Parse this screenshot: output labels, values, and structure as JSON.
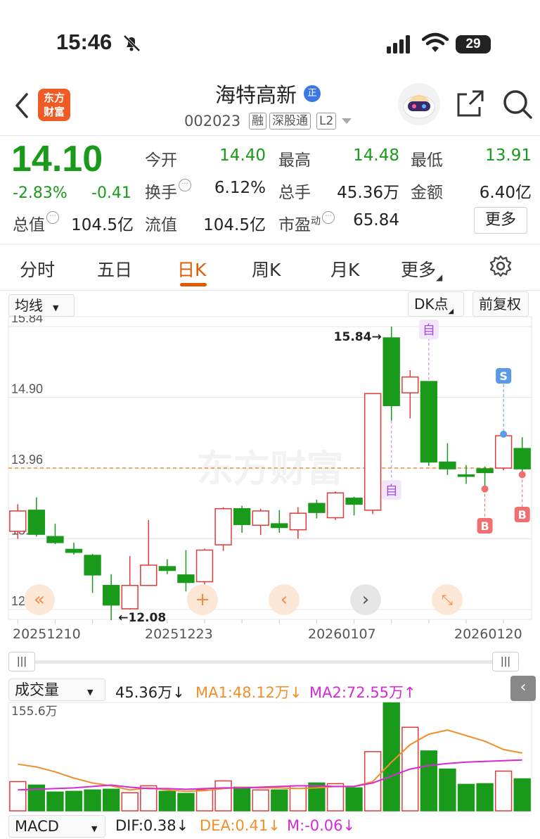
{
  "status": {
    "time": "15:46",
    "battery": "29"
  },
  "header": {
    "logo_text_1": "东方",
    "logo_text_2": "财富",
    "stock_name": "海特高新",
    "badge": "正",
    "stock_code": "002023",
    "tags": [
      "融",
      "深股通",
      "L2"
    ]
  },
  "quote": {
    "price": "14.10",
    "change_pct": "-2.83%",
    "change": "-0.41",
    "open_label": "今开",
    "open": "14.40",
    "high_label": "最高",
    "high": "14.48",
    "low_label": "最低",
    "low": "13.91",
    "turnover_label": "换手",
    "turnover": "6.12%",
    "volume_label": "总手",
    "volume": "45.36万",
    "amount_label": "金额",
    "amount": "6.40亿",
    "mcap_label": "总值",
    "mcap": "104.5亿",
    "float_label": "流值",
    "float": "104.5亿",
    "pe_label": "市盈",
    "pe_sup": "动",
    "pe": "65.84",
    "more": "更多"
  },
  "tabs": [
    "分时",
    "五日",
    "日K",
    "周K",
    "月K",
    "更多"
  ],
  "active_tab": "日K",
  "toolbar": {
    "ma_select": "均线",
    "dk": "DK点",
    "adjust": "前复权"
  },
  "chart_data": {
    "type": "candlestick",
    "y_ticks": [
      "15.84",
      "14.90",
      "13.96",
      "13.02",
      "12.08"
    ],
    "ylim": [
      12.08,
      15.84
    ],
    "x_ticks": [
      "20251210",
      "20251223",
      "20260107",
      "20260120"
    ],
    "high_marker": "15.84",
    "low_marker": "12.08",
    "last_close_line": 13.96,
    "candles": [
      {
        "o": 13.12,
        "c": 13.39,
        "h": 13.48,
        "l": 13.02
      },
      {
        "o": 13.4,
        "c": 13.08,
        "h": 13.57,
        "l": 13.05
      },
      {
        "o": 13.05,
        "c": 12.97,
        "h": 13.22,
        "l": 12.95
      },
      {
        "o": 12.88,
        "c": 12.84,
        "h": 12.97,
        "l": 12.81
      },
      {
        "o": 12.8,
        "c": 12.54,
        "h": 12.82,
        "l": 12.3
      },
      {
        "o": 12.4,
        "c": 12.14,
        "h": 12.55,
        "l": 11.94
      },
      {
        "o": 12.09,
        "c": 12.4,
        "h": 12.79,
        "l": 12.08
      },
      {
        "o": 12.4,
        "c": 12.67,
        "h": 13.27,
        "l": 12.4
      },
      {
        "o": 12.65,
        "c": 12.6,
        "h": 12.75,
        "l": 12.55
      },
      {
        "o": 12.54,
        "c": 12.44,
        "h": 12.87,
        "l": 12.32
      },
      {
        "o": 12.45,
        "c": 12.87,
        "h": 12.89,
        "l": 12.33
      },
      {
        "o": 12.94,
        "c": 13.42,
        "h": 13.44,
        "l": 12.86
      },
      {
        "o": 13.42,
        "c": 13.21,
        "h": 13.46,
        "l": 13.1
      },
      {
        "o": 13.2,
        "c": 13.39,
        "h": 13.42,
        "l": 13.07
      },
      {
        "o": 13.22,
        "c": 13.17,
        "h": 13.4,
        "l": 13.1
      },
      {
        "o": 13.14,
        "c": 13.36,
        "h": 13.44,
        "l": 13.02
      },
      {
        "o": 13.49,
        "c": 13.37,
        "h": 13.54,
        "l": 13.29
      },
      {
        "o": 13.3,
        "c": 13.63,
        "h": 13.65,
        "l": 13.27
      },
      {
        "o": 13.56,
        "c": 13.48,
        "h": 13.58,
        "l": 13.33
      },
      {
        "o": 13.4,
        "c": 14.95,
        "h": 14.95,
        "l": 13.35
      },
      {
        "o": 15.69,
        "c": 14.79,
        "h": 15.84,
        "l": 14.59
      },
      {
        "o": 14.96,
        "c": 15.17,
        "h": 15.26,
        "l": 14.62
      },
      {
        "o": 15.11,
        "c": 14.04,
        "h": 15.11,
        "l": 13.99
      },
      {
        "o": 14.04,
        "c": 13.95,
        "h": 14.29,
        "l": 13.87
      },
      {
        "o": 13.87,
        "c": 13.85,
        "h": 14.0,
        "l": 13.75
      },
      {
        "o": 13.95,
        "c": 13.9,
        "h": 13.98,
        "l": 13.72
      },
      {
        "o": 13.96,
        "c": 14.39,
        "h": 14.41,
        "l": 13.93
      },
      {
        "o": 14.22,
        "c": 13.95,
        "h": 14.37,
        "l": 13.91
      }
    ],
    "markers": {
      "zi": "自",
      "s": "S",
      "b": "B"
    },
    "watermark": "东方财富"
  },
  "volume": {
    "select": "成交量",
    "value": "45.36万",
    "value_arrow": "↓",
    "ma1": "MA1:48.12万",
    "ma1_arrow": "↓",
    "ma2": "MA2:72.55万",
    "ma2_arrow": "↑",
    "max_label": "155.6万",
    "bars": [
      42,
      37,
      27,
      28,
      30,
      31,
      26,
      36,
      28,
      25,
      30,
      43,
      34,
      30,
      30,
      36,
      40,
      39,
      33,
      85,
      155,
      120,
      86,
      60,
      38,
      39,
      57,
      46
    ],
    "ma1_line": [
      67,
      63,
      56,
      47,
      40,
      36,
      30,
      33,
      30,
      28,
      29,
      32,
      34,
      33,
      33,
      32,
      33,
      35,
      35,
      42,
      70,
      95,
      110,
      116,
      108,
      100,
      88,
      83
    ],
    "ma2_line": [
      30,
      31,
      32,
      33,
      35,
      37,
      34,
      32,
      32,
      31,
      32,
      33,
      33,
      34,
      35,
      36,
      36,
      35,
      35,
      40,
      50,
      60,
      65,
      68,
      70,
      71,
      72,
      73
    ],
    "ymax": 155.6
  },
  "macd": {
    "select": "MACD",
    "dif": "DIF:0.38",
    "dif_arrow": "↓",
    "dea": "DEA:0.41",
    "dea_arrow": "↓",
    "m": "M:-0.06",
    "m_arrow": "↓"
  },
  "colors": {
    "up": "#e03a3a",
    "down": "#1a9a1a",
    "accent": "#e05a00",
    "ma1": "#f0902a",
    "ma2": "#d62ad6"
  }
}
